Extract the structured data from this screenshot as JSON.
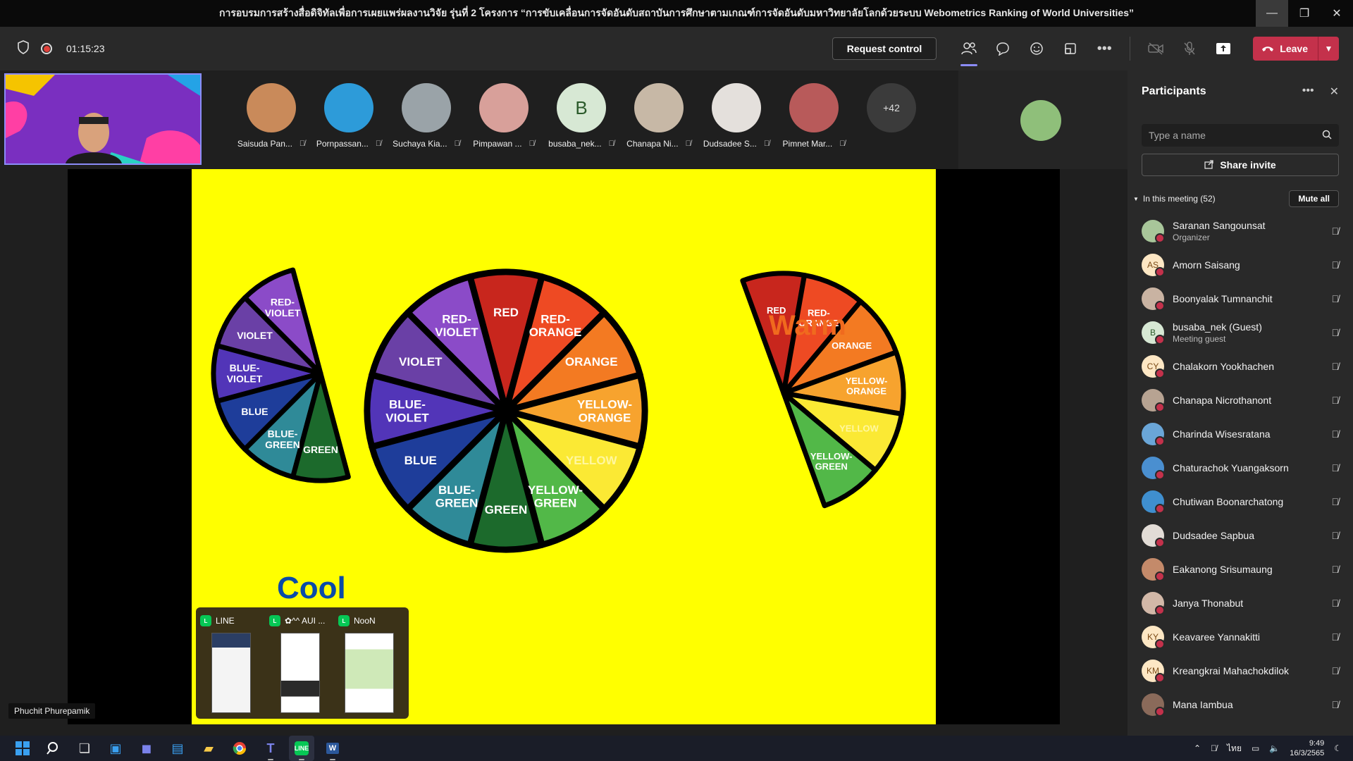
{
  "window": {
    "title": "การอบรมการสร้างสื่อดิจิทัลเพื่อการเผยแพร่ผลงานวิจัย รุ่นที่ 2 โครงการ “การขับเคลื่อนการจัดอันดับสถาบันการศึกษาตามเกณฑ์การจัดอันดับมหาวิทยาลัยโลกด้วยระบบ Webometrics Ranking of World Universities”"
  },
  "toolbar": {
    "timer": "01:15:23",
    "request_control": "Request control",
    "leave": "Leave"
  },
  "stage": {
    "participants": [
      {
        "name": "Saisuda Pan...",
        "avatar_color": "#c98a5a"
      },
      {
        "name": "Pornpassan...",
        "avatar_color": "#2d9bd9"
      },
      {
        "name": "Suchaya Kia...",
        "avatar_color": "#9aa3a8"
      },
      {
        "name": "Pimpawan ...",
        "avatar_color": "#d8a09a"
      },
      {
        "name": "busaba_nek...",
        "avatar_color": "#d7e8d4",
        "initial": "B"
      },
      {
        "name": "Chanapa Ni...",
        "avatar_color": "#c7b8a6"
      },
      {
        "name": "Dudsadee S...",
        "avatar_color": "#e4e0dc"
      },
      {
        "name": "Pimnet Mar...",
        "avatar_color": "#b85a5a"
      }
    ],
    "more_count": "+42",
    "presenter_name": "Phuchit Phurepamik",
    "slide": {
      "cool_label": "Cool",
      "warm_label": "Warm",
      "colors": {
        "RED": "#c8261d",
        "RED-ORANGE": "#ee4a23",
        "ORANGE": "#f37a22",
        "YELLOW-ORANGE": "#f7a32e",
        "YELLOW": "#fbe934",
        "YELLOW-GREEN": "#52b848",
        "GREEN": "#1c6a2c",
        "BLUE-GREEN": "#2f8a98",
        "BLUE": "#1e3d9a",
        "BLUE-VIOLET": "#5235b8",
        "VIOLET": "#6a40a6",
        "RED-VIOLET": "#8b4bc8"
      },
      "main_wheel": [
        "RED",
        "RED-ORANGE",
        "ORANGE",
        "YELLOW-ORANGE",
        "YELLOW",
        "YELLOW-GREEN",
        "GREEN",
        "BLUE-GREEN",
        "BLUE",
        "BLUE-VIOLET",
        "VIOLET",
        "RED-VIOLET"
      ],
      "cool_wheel": [
        "RED-VIOLET",
        "VIOLET",
        "BLUE-VIOLET",
        "BLUE",
        "BLUE-GREEN",
        "GREEN"
      ],
      "warm_wheel": [
        "RED",
        "RED-ORANGE",
        "ORANGE",
        "YELLOW-ORANGE",
        "YELLOW",
        "YELLOW-GREEN"
      ]
    },
    "line_popup": [
      {
        "label": "LINE"
      },
      {
        "label": "✿^^ AUI ..."
      },
      {
        "label": "NooN"
      }
    ]
  },
  "panel": {
    "title": "Participants",
    "search_placeholder": "Type a name",
    "share_invite": "Share invite",
    "in_meeting": "In this meeting (52)",
    "mute_all": "Mute all",
    "people": [
      {
        "name": "Saranan Sangounsat",
        "role": "Organizer",
        "type": "photo"
      },
      {
        "name": "Amorn Saisang",
        "initials": "AS",
        "type": "initials"
      },
      {
        "name": "Boonyalak Tumnanchit",
        "type": "photo"
      },
      {
        "name": "busaba_nek (Guest)",
        "role": "Meeting guest",
        "initials": "B",
        "type": "guest"
      },
      {
        "name": "Chalakorn Yookhachen",
        "initials": "CY",
        "type": "initials"
      },
      {
        "name": "Chanapa Nicrothanont",
        "type": "photo"
      },
      {
        "name": "Charinda Wisesratana",
        "type": "photo"
      },
      {
        "name": "Chaturachok Yuangaksorn",
        "type": "photo"
      },
      {
        "name": "Chutiwan Boonarchatong",
        "type": "photo"
      },
      {
        "name": "Dudsadee Sapbua",
        "type": "photo"
      },
      {
        "name": "Eakanong Srisumaung",
        "type": "photo"
      },
      {
        "name": "Janya Thonabut",
        "type": "photo"
      },
      {
        "name": "Keavaree Yannakitti",
        "initials": "KY",
        "type": "initials"
      },
      {
        "name": "Kreangkrai Mahachokdilok",
        "initials": "KM",
        "type": "initials"
      },
      {
        "name": "Mana Iambua",
        "type": "photo"
      }
    ]
  },
  "taskbar": {
    "language": "ไทย",
    "time": "9:49",
    "date": "16/3/2565"
  }
}
